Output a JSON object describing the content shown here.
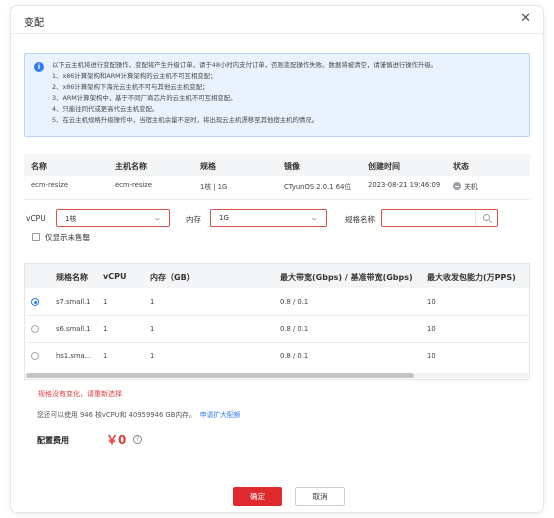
{
  "dialog": {
    "title": "变配",
    "close_icon": "close-icon"
  },
  "notice": {
    "icon": "info-icon",
    "lines": [
      "以下云主机将进行变配操作，变配将产生升级订单，请于48小时内支付订单，否则变配操作失败。数据将被清空，请谨慎进行操作升级。",
      "1、x86计算架构和ARM计算架构的云主机不可互相变配；",
      "2、x86计算架构下海光云主机不可与其他云主机变配；",
      "3、ARM计算架构中，基于不同厂商芯片的云主机不可互相变配。",
      "4、只能往同代或更高代云主机变配。",
      "5、在云主机规格升级操作中，当宿主机余量不足时，将出现云主机漂移至其他宿主机的情况。"
    ]
  },
  "instance_table": {
    "headers": [
      "名称",
      "主机名称",
      "规格",
      "镜像",
      "创建时间",
      "状态"
    ],
    "row": {
      "name": "ecm-resize",
      "host": "ecm-resize",
      "spec": "1核 | 1G",
      "image": "CTyunOS 2.0.1 64位",
      "created": "2023-08-21 19:46:09",
      "status": "关机"
    }
  },
  "filters": {
    "vcpu_label": "vCPU",
    "vcpu_value": "1核",
    "mem_label": "内存",
    "mem_value": "1G",
    "spec_name_label": "规格名称",
    "spec_name_value": "",
    "only_unsold_label": "仅显示未售罄"
  },
  "spec_table": {
    "headers": [
      "规格名称",
      "vCPU",
      "内存（GB）",
      "最大带宽(Gbps) / 基准带宽(Gbps)",
      "最大收发包能力(万PPS)"
    ],
    "rows": [
      {
        "name": "s7.small.1",
        "vcpu": "1",
        "mem": "1",
        "bw": "0.8 / 0.1",
        "pps": "10",
        "selected": true
      },
      {
        "name": "s6.small.1",
        "vcpu": "1",
        "mem": "1",
        "bw": "0.8 / 0.1",
        "pps": "10",
        "selected": false
      },
      {
        "name": "hs1.sma...",
        "vcpu": "1",
        "mem": "1",
        "bw": "0.8 / 0.1",
        "pps": "10",
        "selected": false
      }
    ]
  },
  "error_text": "规格没有变化，请重新选择",
  "quota": {
    "text": "您还可以使用 946 核vCPU和 40959946 GB内存。",
    "link": "申请扩大配额"
  },
  "fee": {
    "label": "配置费用",
    "value": "￥0"
  },
  "buttons": {
    "confirm": "确定",
    "cancel": "取消"
  },
  "colors": {
    "primary_red": "#e0292d",
    "accent_blue": "#2f7bf6",
    "notice_bg": "#eaf2fd"
  }
}
